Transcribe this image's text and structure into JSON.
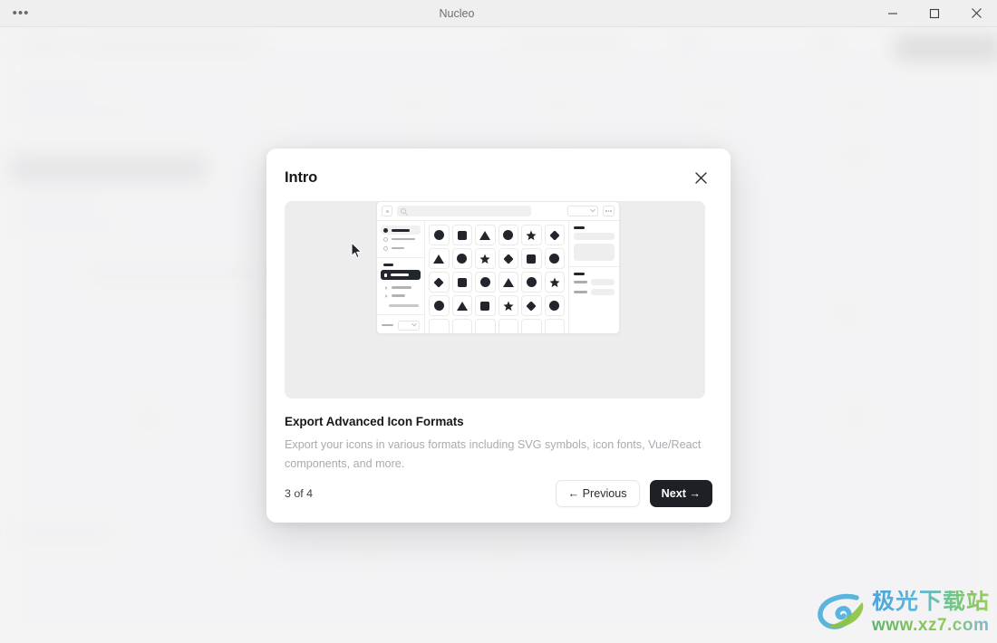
{
  "window": {
    "title": "Nucleo",
    "menu_icon": "ellipsis-icon",
    "minimize_label": "Minimize",
    "maximize_label": "Maximize",
    "close_label": "Close"
  },
  "modal": {
    "title": "Intro",
    "close_icon": "close-icon",
    "copy": {
      "heading": "Export Advanced Icon Formats",
      "description": "Export your icons in various formats including SVG symbols, icon fonts, Vue/React components, and more."
    },
    "footer": {
      "pager": "3 of 4",
      "previous_label": "← Previous",
      "next_label": "Next →"
    }
  },
  "illustration": {
    "name": "app-preview-illustration",
    "toolbar": {
      "add_button": "add-icon",
      "search_placeholder": "",
      "select_value": "",
      "overflow": "more-options-icon"
    },
    "left_panel": {
      "radio_items": [
        {
          "selected": true
        },
        {
          "selected": false
        },
        {
          "selected": false
        }
      ],
      "tree_items": 2
    },
    "grid": {
      "rows": [
        [
          "circle",
          "square",
          "triangle",
          "circle",
          "star",
          "diamond"
        ],
        [
          "triangle",
          "circle",
          "star",
          "diamond",
          "square",
          "circle"
        ],
        [
          "diamond",
          "square",
          "circle",
          "triangle",
          "circle",
          "star"
        ],
        [
          "circle",
          "triangle",
          "square",
          "star",
          "diamond",
          "circle"
        ],
        [
          "empty",
          "empty",
          "empty",
          "empty",
          "empty",
          "empty"
        ]
      ]
    },
    "right_panel": {
      "kv_rows": 2
    },
    "cursor": "mouse-pointer-icon"
  },
  "watermark": {
    "cn": "极光下载站",
    "url": "www.xz7.com"
  },
  "colors": {
    "ink": "#1d2025",
    "modal_bg": "#ffffff",
    "illus_bg": "#ededee",
    "muted_text": "#a9abb0",
    "app_bg": "#f2f2f2"
  }
}
